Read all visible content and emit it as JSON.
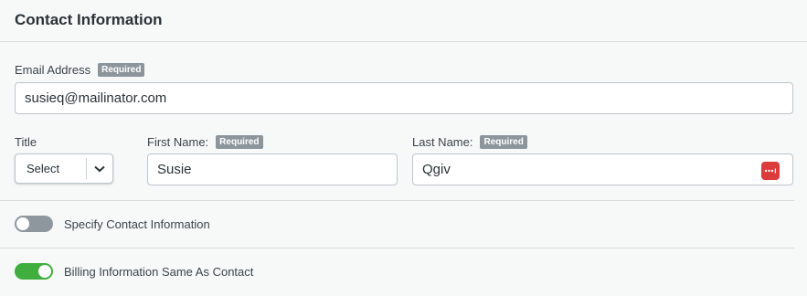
{
  "header": {
    "title": "Contact Information"
  },
  "email": {
    "label": "Email Address",
    "badge": "Required",
    "value": "susieq@mailinator.com"
  },
  "title_field": {
    "label": "Title",
    "selected": "Select"
  },
  "first_name": {
    "label": "First Name:",
    "badge": "Required",
    "value": "Susie"
  },
  "last_name": {
    "label": "Last Name:",
    "badge": "Required",
    "value": "Qgiv"
  },
  "toggles": [
    {
      "label": "Specify Contact Information",
      "on": false
    },
    {
      "label": "Billing Information Same As Contact",
      "on": true
    }
  ],
  "colors": {
    "toggle_on": "#3fae3f",
    "toggle_off": "#8e979e",
    "password_icon": "#dc3b3b"
  },
  "icons": {
    "select_arrow": "chevron-down-icon",
    "password_manager": "password-manager-icon"
  }
}
